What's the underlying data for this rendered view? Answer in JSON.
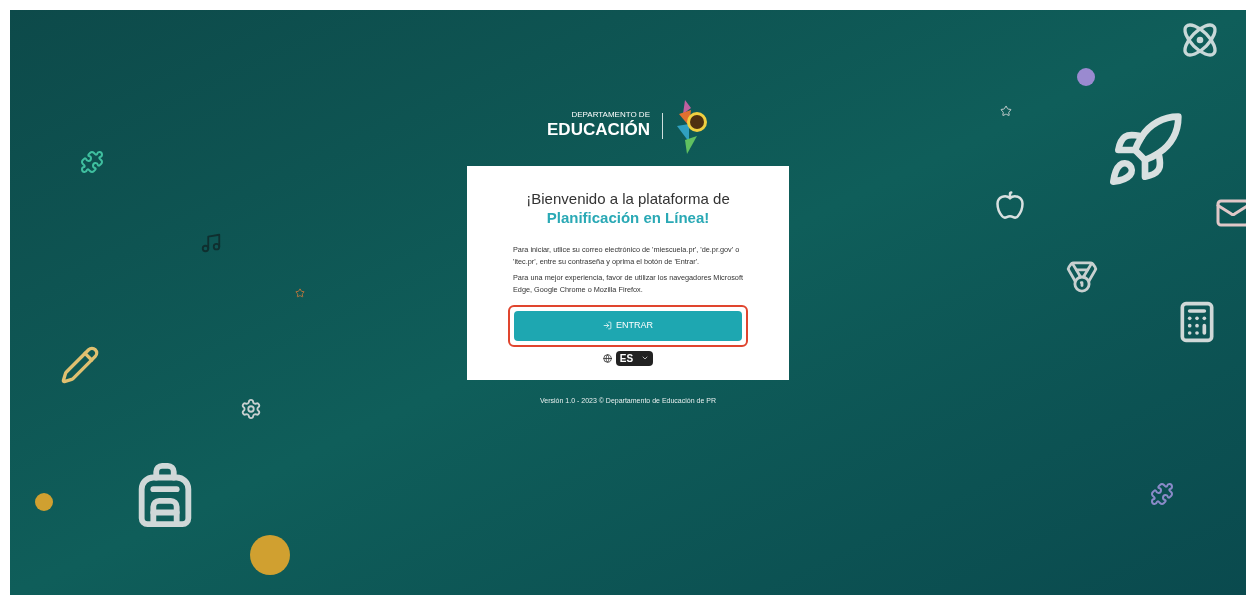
{
  "logo": {
    "line_1": "DEPARTAMENTO DE",
    "line_2": "EDUCACIÓN"
  },
  "card": {
    "title": "¡Bienvenido a la plataforma de",
    "title_highlight": "Planificación en Línea!",
    "paragraphs": [
      "Para iniciar, utlice su correo electrónico de 'miescuela.pr', 'de.pr.gov' o 'itec.pr', entre su contraseña y oprima el botón de 'Entrar'.",
      "Para una mejor experiencia, favor de utilizar los navegadores Microsoft Edge, Google Chrome o Mozilla Firefox."
    ],
    "button": {
      "label": "ENTRAR",
      "highlighted": true
    },
    "language": {
      "value": "ES"
    }
  },
  "footer": "Versión 1.0 - 2023 © Departamento de Educación de PR"
}
